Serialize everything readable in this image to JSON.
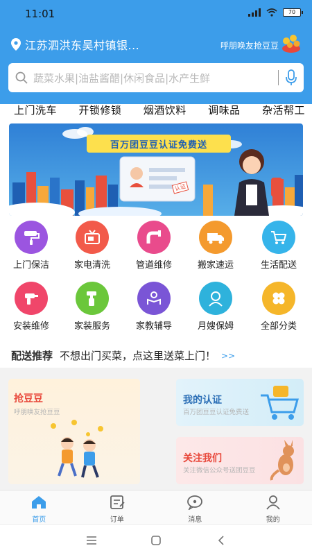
{
  "status": {
    "time": "11:01",
    "battery": "70"
  },
  "header": {
    "location": "江苏泗洪东吴村镇银...",
    "invite_label": "呼朋唤友抢豆豆"
  },
  "search": {
    "placeholder": "蔬菜水果|油盐酱醋|休闲食品|水产生鲜"
  },
  "quick_tabs": [
    "上门洗车",
    "开锁修锁",
    "烟酒饮料",
    "调味品",
    "杂活帮工"
  ],
  "banner": {
    "headline": "百万团豆豆认证免费送",
    "stamp": "认证"
  },
  "services": [
    {
      "label": "上门保洁",
      "icon": "paint-roller-icon",
      "color": "#9b55e0"
    },
    {
      "label": "家电清洗",
      "icon": "tv-icon",
      "color": "#f25a4a"
    },
    {
      "label": "管道维修",
      "icon": "pipe-icon",
      "color": "#e94b8c"
    },
    {
      "label": "搬家速运",
      "icon": "truck-icon",
      "color": "#f49a2e"
    },
    {
      "label": "生活配送",
      "icon": "cart-icon",
      "color": "#36b4ea"
    },
    {
      "label": "安装维修",
      "icon": "drill-icon",
      "color": "#f0466a"
    },
    {
      "label": "家装服务",
      "icon": "paint-brush-icon",
      "color": "#6bc73b"
    },
    {
      "label": "家教辅导",
      "icon": "tutor-icon",
      "color": "#7a55d6"
    },
    {
      "label": "月嫂保姆",
      "icon": "nanny-icon",
      "color": "#2eb2dc"
    },
    {
      "label": "全部分类",
      "icon": "clover-icon",
      "color": "#f5b62a"
    }
  ],
  "recommend": {
    "title": "配送推荐",
    "text": "不想出门买菜，点这里送菜上门！",
    "more": ">>"
  },
  "cards": {
    "grab": {
      "title": "抢豆豆",
      "sub": "呼朋唤友抢豆豆"
    },
    "auth": {
      "title": "我的认证",
      "sub": "百万团豆豆认证免费送"
    },
    "follow": {
      "title": "关注我们",
      "sub": "关注微信公众号送团豆豆"
    }
  },
  "tabbar": [
    {
      "label": "首页",
      "icon": "home-icon",
      "active": true
    },
    {
      "label": "订单",
      "icon": "order-icon",
      "active": false
    },
    {
      "label": "消息",
      "icon": "message-icon",
      "active": false
    },
    {
      "label": "我的",
      "icon": "profile-icon",
      "active": false
    }
  ],
  "colors": {
    "primary": "#3c9dea",
    "accent_red": "#e8473a"
  }
}
